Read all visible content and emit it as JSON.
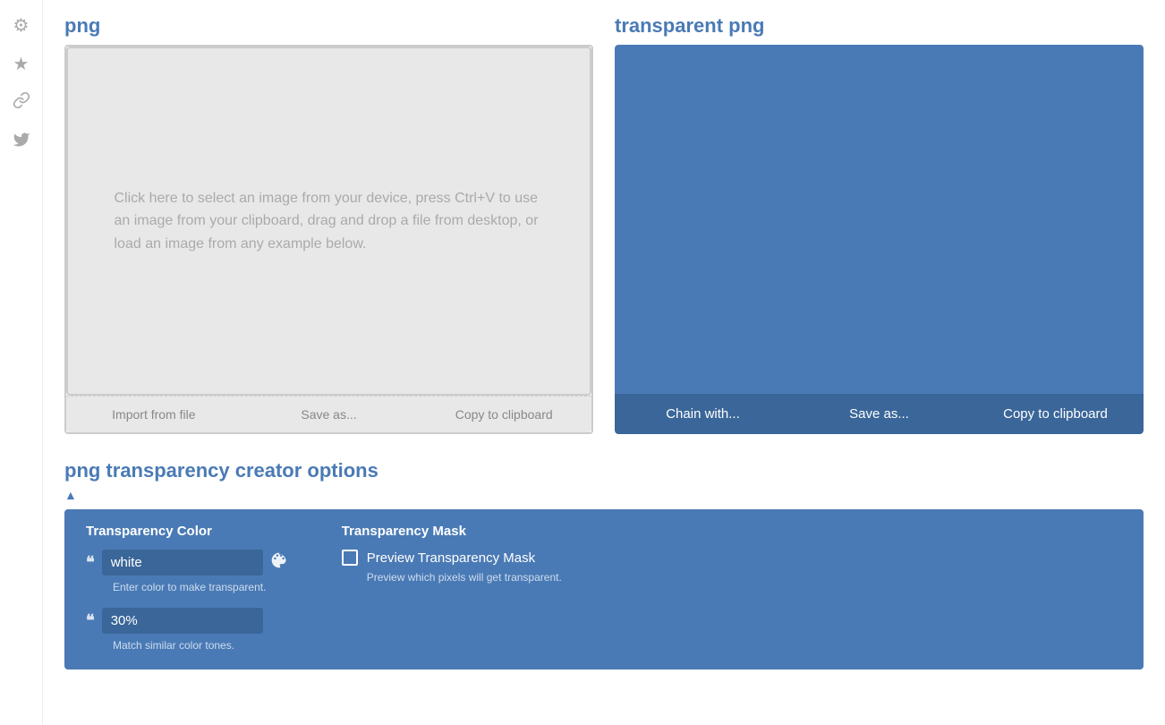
{
  "sidebar": {
    "icons": [
      {
        "name": "gear-icon",
        "symbol": "⚙"
      },
      {
        "name": "star-icon",
        "symbol": "★"
      },
      {
        "name": "link-icon",
        "symbol": "🔗"
      },
      {
        "name": "twitter-icon",
        "symbol": "🐦"
      }
    ]
  },
  "png_panel": {
    "title": "png",
    "drop_area_text": "Click here to select an image from your device, press Ctrl+V to use an image from your clipboard, drag and drop a file from desktop, or load an image from any example below.",
    "actions": {
      "import": "Import from file",
      "save": "Save as...",
      "copy": "Copy to clipboard"
    }
  },
  "transparent_panel": {
    "title": "transparent png",
    "actions": {
      "chain": "Chain with...",
      "save": "Save as...",
      "copy": "Copy to clipboard"
    }
  },
  "options": {
    "title": "png transparency creator options",
    "transparency_color": {
      "label": "Transparency Color",
      "value": "white",
      "hint": "Enter color to make transparent."
    },
    "tolerance": {
      "value": "30%",
      "hint": "Match similar color tones."
    },
    "transparency_mask": {
      "label": "Transparency Mask",
      "checkbox_label": "Preview Transparency Mask",
      "checkbox_hint": "Preview which pixels will get transparent."
    }
  },
  "colors": {
    "accent": "#4a7ab5",
    "dark_blue": "#3a6699",
    "panel_bg": "#4a7ab5"
  }
}
